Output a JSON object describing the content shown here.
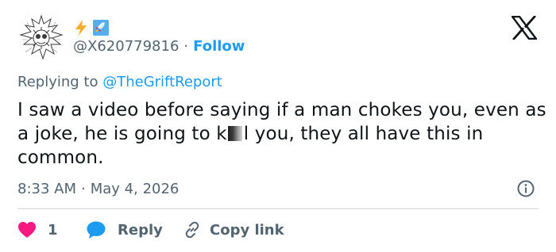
{
  "user": {
    "handle": "@X620779816",
    "separator": "·",
    "follow_label": "Follow",
    "display_emojis": [
      "lightning-emoji",
      "rocket-emoji"
    ]
  },
  "reply_context": {
    "prefix": "Replying to",
    "mention": "@TheGriftReport"
  },
  "tweet": {
    "text_before_censor": "I saw a video before saying if a man chokes you, even as a joke, he is going to k",
    "text_after_censor": "l you, they all have this in common."
  },
  "meta": {
    "time": "8:33 AM",
    "separator": "·",
    "date": "May 4, 2026"
  },
  "actions": {
    "like_count": "1",
    "reply_label": "Reply",
    "copy_label": "Copy link"
  },
  "colors": {
    "link_blue": "#1d9bf0",
    "muted_gray": "#536471",
    "text_dark": "#0f1419",
    "like_red": "#f91880",
    "divider": "#cfd9de"
  },
  "icons": {
    "brand": "x-logo-icon",
    "info": "info-icon",
    "like": "heart-icon",
    "reply": "speech-bubble-icon",
    "copy": "link-icon"
  }
}
